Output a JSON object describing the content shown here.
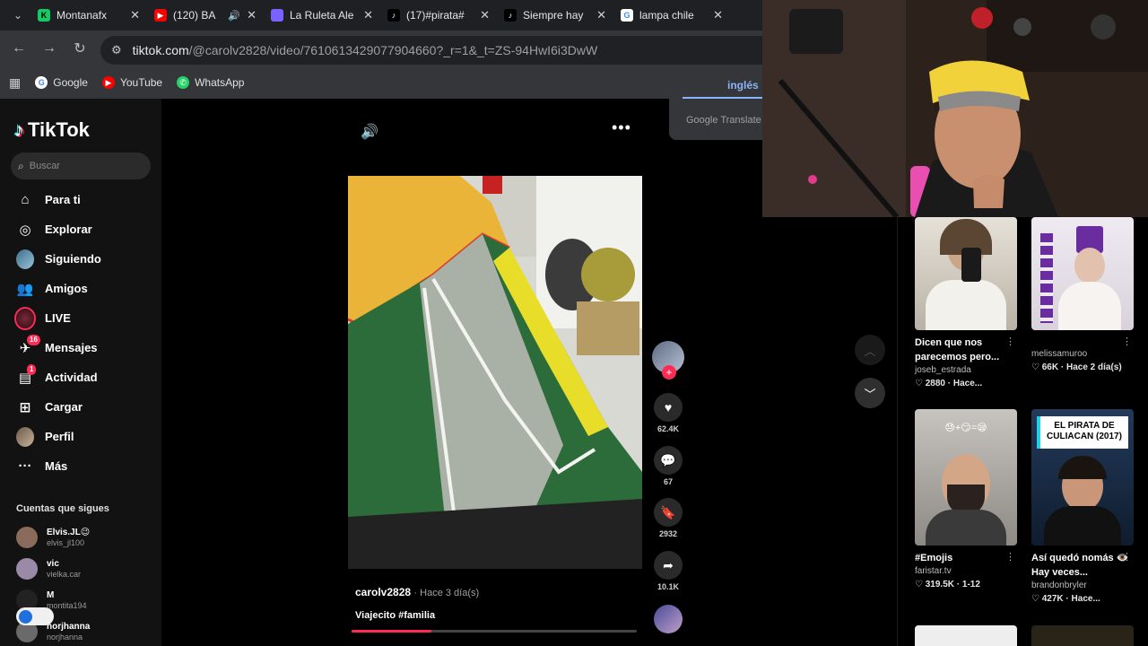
{
  "browser": {
    "tabs": [
      {
        "title": "Montanafx",
        "fav_color": "#17c964",
        "fav_letter": "K",
        "fav_text": "#000"
      },
      {
        "title": "(120) BA",
        "fav_color": "#ff0000",
        "fav_letter": "▶",
        "fav_text": "#fff"
      },
      {
        "title": "La Ruleta Ale",
        "fav_color": "#7b61ff",
        "fav_letter": "",
        "fav_text": "#fff"
      },
      {
        "title": "(17)#pirata#",
        "fav_color": "#000000",
        "fav_letter": "♪",
        "fav_text": "#fff"
      },
      {
        "title": "Siempre hay",
        "fav_color": "#000000",
        "fav_letter": "♪",
        "fav_text": "#fff"
      },
      {
        "title": "lampa chile",
        "fav_color": "#ffffff",
        "fav_letter": "G",
        "fav_text": "#4285f4"
      }
    ],
    "url_host": "tiktok.com",
    "url_rest": "/@carolv2828/video/7610613429077904660?_r=1&_t=ZS-94HwI6i3DwW",
    "bookmarks": [
      {
        "label": "Google",
        "color": "#ffffff",
        "glyph": "G",
        "text": "#4285f4"
      },
      {
        "label": "YouTube",
        "color": "#ff0000",
        "glyph": "▶",
        "text": "#fff"
      },
      {
        "label": "WhatsApp",
        "color": "#25d366",
        "glyph": "✆",
        "text": "#fff"
      }
    ],
    "translate": {
      "language": "inglés",
      "brand": "Google Translate"
    }
  },
  "sidebar": {
    "logo": "TikTok",
    "search_placeholder": "Buscar",
    "nav": [
      {
        "label": "Para ti",
        "icon": "home-icon"
      },
      {
        "label": "Explorar",
        "icon": "compass-icon"
      },
      {
        "label": "Siguiendo",
        "icon": "following-avatar-icon"
      },
      {
        "label": "Amigos",
        "icon": "friends-icon"
      },
      {
        "label": "LIVE",
        "icon": "live-icon"
      },
      {
        "label": "Mensajes",
        "icon": "messages-icon",
        "badge": "16"
      },
      {
        "label": "Actividad",
        "icon": "activity-icon",
        "badge": "1"
      },
      {
        "label": "Cargar",
        "icon": "upload-icon"
      },
      {
        "label": "Perfil",
        "icon": "profile-icon"
      },
      {
        "label": "Más",
        "icon": "more-icon"
      }
    ],
    "following_title": "Cuentas que sigues",
    "following": [
      {
        "name": "Elvis.JL😉",
        "handle": "elvis_jl100"
      },
      {
        "name": "vic",
        "handle": "vielka.car"
      },
      {
        "name": "M",
        "handle": "montita194"
      },
      {
        "name": "norjhanna",
        "handle": "norjhanna"
      }
    ]
  },
  "video": {
    "author": "carolv2828",
    "time": "Hace 3 día(s)",
    "caption": "Viajecito #familia",
    "progress": 0.28,
    "likes": "62.4K",
    "comments": "67",
    "saves": "2932",
    "shares": "10.1K"
  },
  "suggested": [
    {
      "title": "Dicen que nos parecemos pero...",
      "user": "joseb_estrada",
      "stats": "2880 · Hace..."
    },
    {
      "title": "",
      "user": "melissamuroo",
      "stats": "66K · Hace 2 día(s)"
    },
    {
      "title": "#Emojis",
      "user": "faristar.tv",
      "stats": "319.5K · 1-12",
      "overlay": "😓+😏=😪"
    },
    {
      "title": "Así quedó nomás 👁️ Hay veces...",
      "user": "brandonbryler",
      "stats": "427K · Hace...",
      "overlay": "EL PIRATA DE CULIACAN (2017)"
    }
  ]
}
